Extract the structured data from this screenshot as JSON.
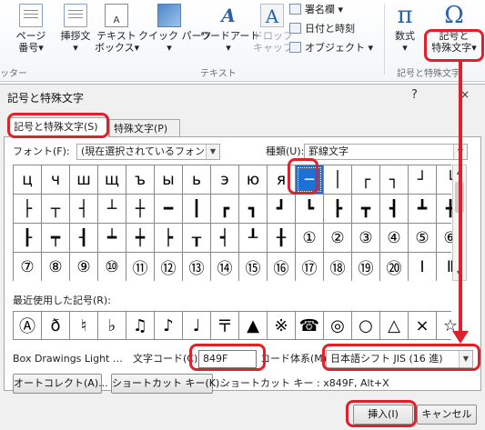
{
  "ribbon": {
    "buttons": [
      {
        "label": "ページ\n番号▾",
        "icon": "page-number-icon",
        "disabled": false
      },
      {
        "label": "挿拶文\n▾",
        "icon": "greeting-icon",
        "disabled": false
      },
      {
        "label": "テキスト\nボックス▾",
        "icon": "text-box-icon",
        "disabled": false
      },
      {
        "label": "クイック パーツ\n▾",
        "icon": "quick-parts-icon",
        "disabled": false
      },
      {
        "label": "ワードアート\n▾",
        "icon": "wordart-icon",
        "disabled": false
      },
      {
        "label": "ドロップ\nキャップ▾",
        "icon": "drop-cap-icon",
        "disabled": true
      }
    ],
    "small_items": [
      "署名欄 ▾",
      "日付と時刻",
      "オブジェクト ▾"
    ],
    "equation": {
      "label": "数式\n▾",
      "glyph": "π"
    },
    "symbol": {
      "label": "記号と\n特殊文字▾",
      "glyph": "Ω"
    },
    "groups": [
      "ッター",
      "テキスト",
      "記号と特殊文字"
    ]
  },
  "dialog": {
    "title": "記号と特殊文字",
    "help": "?",
    "close": "×",
    "tabs": [
      "記号と特殊文字(S)",
      "特殊文字(P)"
    ],
    "font_label": "フォント(F):",
    "font_value": "(現在選択されているフォント)",
    "subset_label": "種類(U):",
    "subset_value": "罫線文字",
    "grid": [
      [
        "ц",
        "ч",
        "ш",
        "щ",
        "ъ",
        "ы",
        "ь",
        "э",
        "ю",
        "я",
        "─",
        "│",
        "┌",
        "┐",
        "┘",
        "└"
      ],
      [
        "├",
        "┬",
        "┤",
        "┴",
        "┼",
        "━",
        "┃",
        "┏",
        "┓",
        "┛",
        "┗",
        "┣",
        "┳",
        "┫",
        "┻",
        "╋"
      ],
      [
        "┠",
        "┯",
        "┨",
        "┷",
        "┿",
        "┝",
        "┰",
        "┥",
        "┸",
        "╂",
        "①",
        "②",
        "③",
        "④",
        "⑤",
        "⑥"
      ],
      [
        "⑦",
        "⑧",
        "⑨",
        "⑩",
        "⑪",
        "⑫",
        "⑬",
        "⑭",
        "⑮",
        "⑯",
        "⑰",
        "⑱",
        "⑲",
        "⑳",
        "Ⅰ",
        "Ⅱ"
      ]
    ],
    "recent_label": "最近使用した記号(R):",
    "recent": [
      "Ⓐ",
      "ð",
      "♮",
      "♭",
      "♫",
      "♪",
      "♩",
      "〒",
      "▲",
      "※",
      "☎",
      "◎",
      "○",
      "△",
      "×",
      "☆"
    ],
    "char_name": "Box Drawings Light …",
    "char_code_label": "文字コード(C):",
    "char_code_value": "849F",
    "from_label": "コード体系(M):",
    "from_value": "日本語シフト JIS (16 進)",
    "autocorrect_btn": "オートコレクト(A)...",
    "shortcut_btn": "ショートカット キー(K)...",
    "shortcut_text": "ショートカット キー : x849F, Alt+X",
    "insert_btn": "挿入(I)",
    "cancel_btn": "キャンセル"
  },
  "colors": {
    "accent": "#e0202a",
    "selection": "#1e6fd6"
  }
}
